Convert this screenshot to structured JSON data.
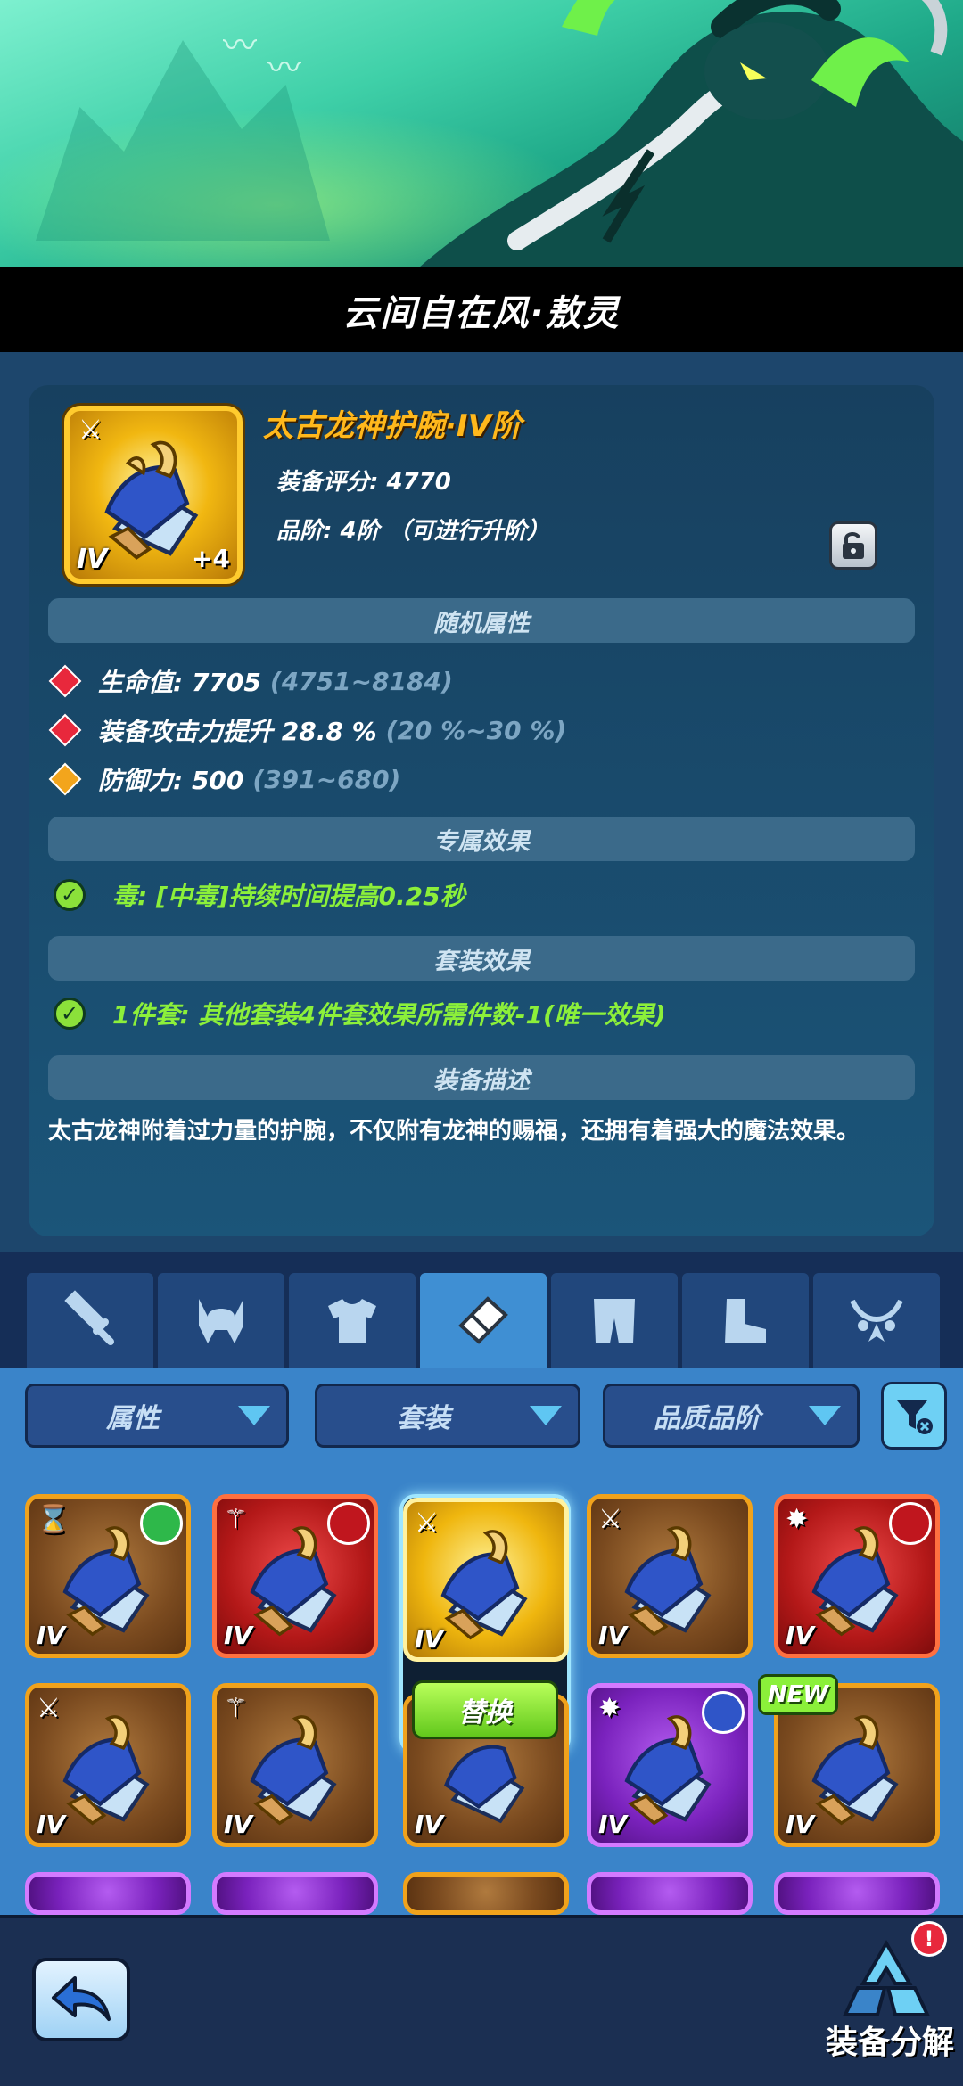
{
  "header": {
    "title": "云间自在风·敖灵"
  },
  "item": {
    "name": "太古龙神护腕·IV阶",
    "score_label": "装备评分: 4770",
    "grade_label": "品阶: 4阶  （可进行升阶）",
    "tier": "IV",
    "plus": "+4",
    "icon": "gauntlet-icon"
  },
  "sections": {
    "random": "随机属性",
    "exclusive": "专属效果",
    "set": "套装效果",
    "description": "装备描述"
  },
  "attributes": [
    {
      "text": "生命值: 7705",
      "range": "(4751~8184)",
      "color": "#e8283c"
    },
    {
      "text": "装备攻击力提升 28.8 %",
      "range": "(20 %~30 %)",
      "color": "#e8283c"
    },
    {
      "text": "防御力: 500",
      "range": "(391~680)",
      "color": "#f3a51c"
    }
  ],
  "exclusive_effect": "毒: [中毒]持续时间提高0.25秒",
  "set_effect": "1件套: 其他套装4件套效果所需件数-1(唯一效果)",
  "description": "太古龙神附着过力量的护腕，不仅附有龙神的赐福，还拥有着强大的魔法效果。",
  "tabs": [
    {
      "icon": "sword-icon"
    },
    {
      "icon": "helmet-icon"
    },
    {
      "icon": "armor-icon"
    },
    {
      "icon": "bracer-icon",
      "active": true
    },
    {
      "icon": "pants-icon"
    },
    {
      "icon": "boots-icon"
    },
    {
      "icon": "necklace-icon"
    }
  ],
  "filters": {
    "attribute": "属性",
    "set": "套装",
    "quality": "品质品阶"
  },
  "grid": {
    "tier_label": "IV",
    "replace_label": "替换",
    "new_label": "NEW"
  },
  "bottom": {
    "dismantle_label": "装备分解",
    "alert": "!"
  }
}
